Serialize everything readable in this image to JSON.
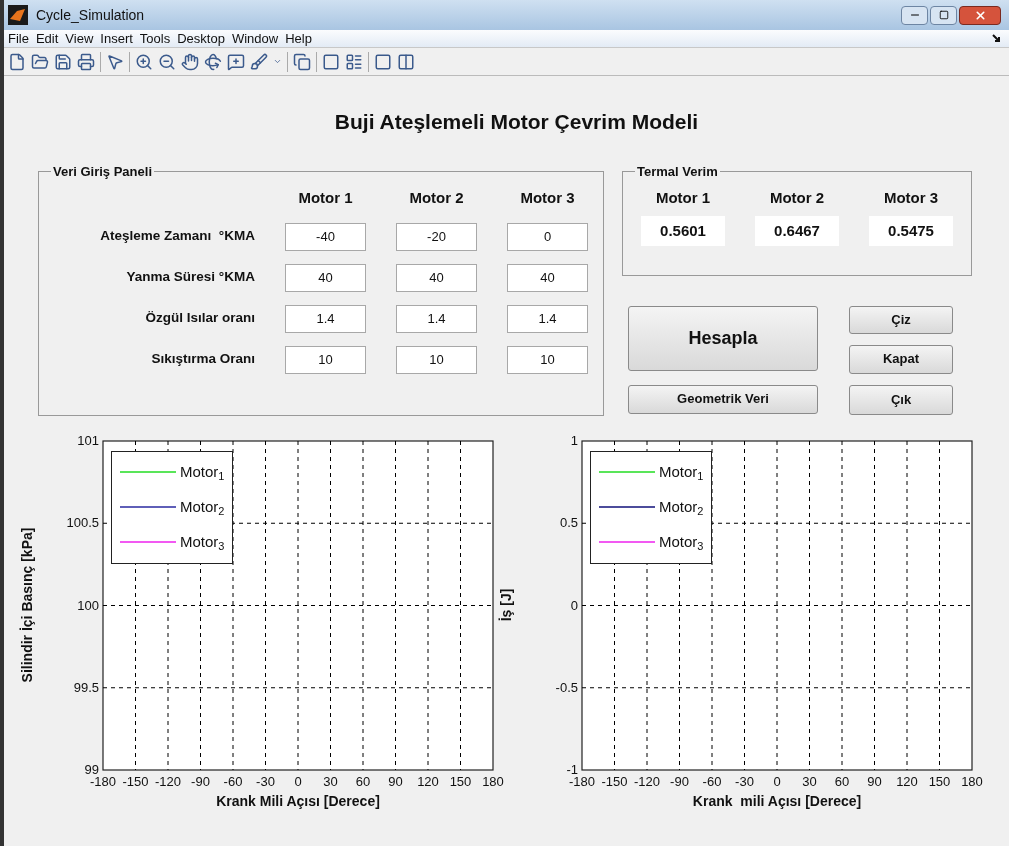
{
  "window": {
    "title": "Cycle_Simulation"
  },
  "menu": [
    "File",
    "Edit",
    "View",
    "Insert",
    "Tools",
    "Desktop",
    "Window",
    "Help"
  ],
  "heading": "Buji Ateşlemeli Motor Çevrim Modeli",
  "input_panel": {
    "title": "Veri Giriş Paneli",
    "columns": [
      "Motor 1",
      "Motor 2",
      "Motor 3"
    ],
    "rows": [
      {
        "label": "Ateşleme Zamanı  °KMA",
        "values": [
          "-40",
          "-20",
          "0"
        ]
      },
      {
        "label": "Yanma Süresi °KMA",
        "values": [
          "40",
          "40",
          "40"
        ]
      },
      {
        "label": "Özgül Isılar oranı",
        "values": [
          "1.4",
          "1.4",
          "1.4"
        ]
      },
      {
        "label": "Sıkıştırma Oranı",
        "values": [
          "10",
          "10",
          "10"
        ]
      }
    ]
  },
  "efficiency_panel": {
    "title": "Termal Verim",
    "columns": [
      "Motor 1",
      "Motor 2",
      "Motor 3"
    ],
    "values": [
      "0.5601",
      "0.6467",
      "0.5475"
    ]
  },
  "buttons": {
    "calculate": "Hesapla",
    "geometry": "Geometrik Veri",
    "draw": "Çiz",
    "close": "Kapat",
    "exit": "Çık"
  },
  "charts": [
    {
      "chart_data": {
        "type": "line",
        "grid": true,
        "xlabel": "Krank Mili Açısı [Derece]",
        "ylabel": "Silindir İçi Basınç [kPa]",
        "ylim": [
          99,
          101
        ],
        "categories": [
          "-180",
          "-150",
          "-120",
          "-90",
          "-60",
          "-30",
          "0",
          "30",
          "60",
          "90",
          "120",
          "150",
          "180"
        ],
        "yticks": [
          99,
          99.5,
          100,
          100.5,
          101
        ],
        "series": [
          {
            "name": "Motor$_{1}$",
            "color": "#22dd22",
            "values": [
              null,
              null,
              null,
              null,
              null,
              null,
              null,
              null,
              null,
              null,
              null,
              null,
              null
            ]
          },
          {
            "name": "Motor$_{2}$",
            "color": "#2a2aa0",
            "values": [
              null,
              null,
              null,
              null,
              null,
              null,
              null,
              null,
              null,
              null,
              null,
              null,
              null
            ]
          },
          {
            "name": "Motor$_{3}$",
            "color": "#ee22ee",
            "values": [
              null,
              null,
              null,
              null,
              null,
              null,
              null,
              null,
              null,
              null,
              null,
              null,
              null
            ]
          }
        ]
      }
    },
    {
      "chart_data": {
        "type": "line",
        "grid": true,
        "xlabel": "Krank  mili Açısı [Derece]",
        "ylabel": "İş [J]",
        "ylim": [
          -1,
          1
        ],
        "categories": [
          "-180",
          "-150",
          "-120",
          "-90",
          "-60",
          "-30",
          "0",
          "30",
          "60",
          "90",
          "120",
          "150",
          "180"
        ],
        "yticks": [
          -1,
          -0.5,
          0,
          0.5,
          1
        ],
        "series": [
          {
            "name": "Motor$_{1}$",
            "color": "#22dd22",
            "values": [
              null,
              null,
              null,
              null,
              null,
              null,
              null,
              null,
              null,
              null,
              null,
              null,
              null
            ]
          },
          {
            "name": "Motor$_{2}$",
            "color": "#10107a",
            "values": [
              null,
              null,
              null,
              null,
              null,
              null,
              null,
              null,
              null,
              null,
              null,
              null,
              null
            ]
          },
          {
            "name": "Motor$_{3}$",
            "color": "#ee22ee",
            "values": [
              null,
              null,
              null,
              null,
              null,
              null,
              null,
              null,
              null,
              null,
              null,
              null,
              null
            ]
          }
        ]
      }
    }
  ]
}
